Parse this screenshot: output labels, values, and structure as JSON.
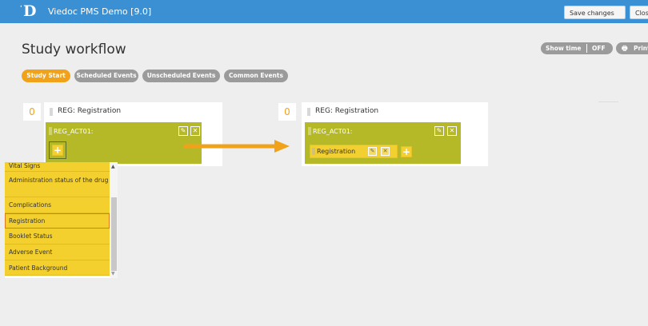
{
  "app": {
    "title": "Viedoc PMS Demo [9.0]",
    "logo_letter": "D",
    "logo_mark": "ˈ"
  },
  "toolbar": {
    "save_changes": "Save changes",
    "close": "Close"
  },
  "page": {
    "title": "Study workflow",
    "show_time_label": "Show time",
    "show_time_value": "OFF",
    "print_label": "Print"
  },
  "tabs": [
    {
      "label": "Study Start",
      "active": true
    },
    {
      "label": "Scheduled Events",
      "active": false
    },
    {
      "label": "Unscheduled Events",
      "active": false
    },
    {
      "label": "Common Events",
      "active": false
    }
  ],
  "left_panel": {
    "count": "0",
    "event_title": "REG: Registration",
    "activity_title": "REG_ACT01:",
    "add_symbol": "+"
  },
  "right_panel": {
    "count": "0",
    "event_title": "REG: Registration",
    "activity_title": "REG_ACT01:",
    "form_label": "Registration",
    "add_symbol": "+"
  },
  "icons": {
    "edit": "✎",
    "close": "✕",
    "print": "🖶"
  },
  "dropdown": {
    "items": [
      "Vital Signs",
      "Administration status of the drug",
      "Complications",
      "Registration",
      "Booklet Status",
      "Adverse Event",
      "Patient Background"
    ],
    "selected": "Registration"
  },
  "colors": {
    "topbar": "#3b8fd3",
    "accent": "#f0a21b",
    "activity": "#b5b928",
    "form": "#f4d02e"
  }
}
